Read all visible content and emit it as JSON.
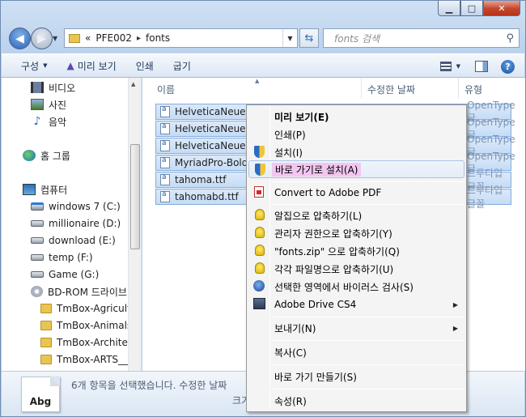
{
  "window": {
    "minimize": "▁",
    "maximize": "□",
    "close": "✕"
  },
  "address": {
    "history_marker": "«",
    "breadcrumbs": [
      "PFE002",
      "fonts"
    ],
    "separator": "▸"
  },
  "search": {
    "placeholder": "fonts 검색",
    "icon": "search-icon"
  },
  "toolbar": {
    "organize": "구성",
    "preview": "미리 보기",
    "print": "인쇄",
    "burn": "굽기"
  },
  "nav": {
    "items": [
      {
        "label": "비디오",
        "icon": "video-icon"
      },
      {
        "label": "사진",
        "icon": "photo-icon"
      },
      {
        "label": "음악",
        "icon": "music-icon"
      },
      {
        "label": "홈 그룹",
        "icon": "homegroup-icon"
      },
      {
        "label": "컴퓨터",
        "icon": "computer-icon"
      },
      {
        "label": "windows 7 (C:)",
        "icon": "drive-c-icon"
      },
      {
        "label": "millionaire (D:)",
        "icon": "drive-icon"
      },
      {
        "label": "download (E:)",
        "icon": "drive-icon"
      },
      {
        "label": "temp (F:)",
        "icon": "drive-icon"
      },
      {
        "label": "Game (G:)",
        "icon": "drive-icon"
      },
      {
        "label": "BD-ROM 드라이브",
        "icon": "disc-icon"
      },
      {
        "label": "TmBox-Agricultu",
        "icon": "folder-icon"
      },
      {
        "label": "TmBox-Animals_",
        "icon": "folder-icon"
      },
      {
        "label": "TmBox-Architec",
        "icon": "folder-icon"
      },
      {
        "label": "TmBox-ARTS__",
        "icon": "folder-icon"
      }
    ]
  },
  "columns": {
    "name": "이름",
    "date": "수정한 날짜",
    "type": "유형"
  },
  "files": [
    {
      "name": "HelveticaNeueLT",
      "type": "OpenType 글"
    },
    {
      "name": "HelveticaNeueLT",
      "type": "OpenType 글"
    },
    {
      "name": "HelveticaNeueLT",
      "type": "OpenType 글"
    },
    {
      "name": "MyriadPro-BoldS",
      "type": "OpenType 글"
    },
    {
      "name": "tahoma.ttf",
      "type": "트루타입 글꼴"
    },
    {
      "name": "tahomabd.ttf",
      "type": "트루타입 글꼴"
    }
  ],
  "details": {
    "thumb": "Abg",
    "summary": "6개 항목을 선택했습니다.  수정한 날짜",
    "size_label": "크기"
  },
  "context_menu": {
    "items": [
      {
        "label": "미리 보기(E)",
        "icon": ""
      },
      {
        "label": "인쇄(P)",
        "icon": ""
      },
      {
        "label": "설치(I)",
        "icon": "uac-shield-icon"
      },
      {
        "label": "바로 가기로 설치(A)",
        "icon": "uac-shield-icon"
      },
      {
        "label": "Convert to Adobe PDF",
        "icon": "pdf-icon"
      },
      {
        "label": "알집으로 압축하기(L)",
        "icon": "alzip-icon"
      },
      {
        "label": "관리자 권한으로 압축하기(Y)",
        "icon": "alzip-shield-icon"
      },
      {
        "label": "\"fonts.zip\" 으로 압축하기(Q)",
        "icon": "alzip-icon"
      },
      {
        "label": "각각 파일명으로 압축하기(U)",
        "icon": "alzip-icon"
      },
      {
        "label": "선택한 영역에서 바이러스 검사(S)",
        "icon": "antivirus-icon"
      },
      {
        "label": "Adobe Drive CS4",
        "icon": "adobe-drive-icon"
      },
      {
        "label": "보내기(N)",
        "icon": ""
      },
      {
        "label": "복사(C)",
        "icon": ""
      },
      {
        "label": "바로 가기 만들기(S)",
        "icon": ""
      },
      {
        "label": "속성(R)",
        "icon": ""
      }
    ],
    "submenu_arrow": "▶"
  },
  "colors": {
    "selection": "#c5dcf6",
    "highlight": "#f3c6f2",
    "chrome": "#b9d1ec"
  }
}
